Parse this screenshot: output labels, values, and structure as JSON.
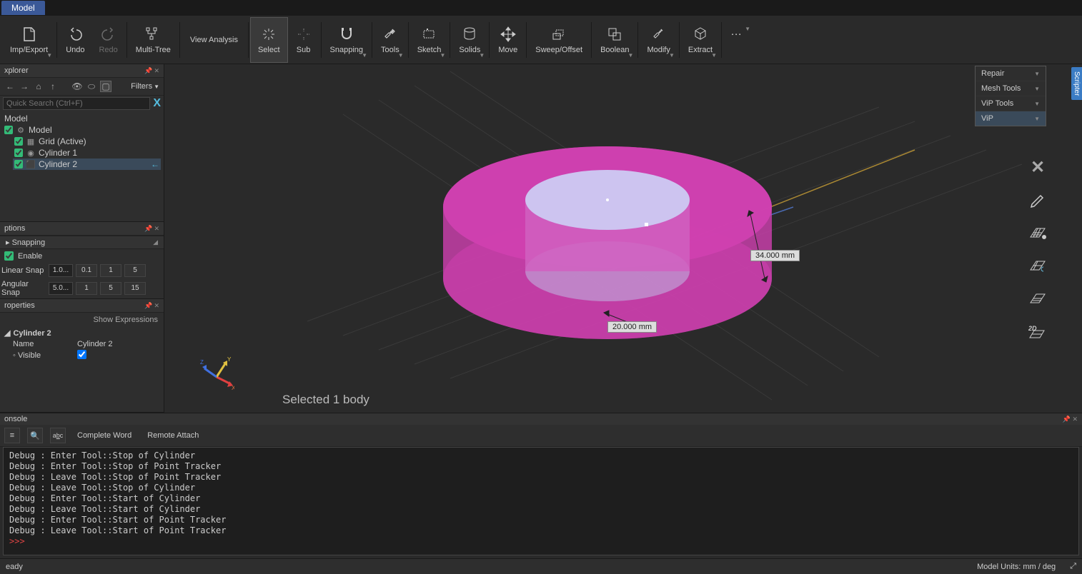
{
  "titlebar": {
    "tab": "Model"
  },
  "ribbon": {
    "import_export": "Imp/Export",
    "undo": "Undo",
    "redo": "Redo",
    "multitree": "Multi-Tree",
    "view_analysis": "View Analysis",
    "select": "Select",
    "sub": "Sub",
    "snapping": "Snapping",
    "tools": "Tools",
    "sketch": "Sketch",
    "solids": "Solids",
    "move": "Move",
    "sweep_offset": "Sweep/Offset",
    "boolean": "Boolean",
    "modify": "Modify",
    "extract": "Extract"
  },
  "repair_popup": {
    "repair": "Repair",
    "meshtools": "Mesh Tools",
    "viptools": "ViP Tools",
    "vip": "ViP"
  },
  "explorer": {
    "title": "xplorer",
    "filters_label": "Filters",
    "search_placeholder": "Quick Search (Ctrl+F)",
    "root": "Model",
    "model_label": "Model",
    "items": [
      {
        "label": "Grid (Active)",
        "checked": true
      },
      {
        "label": "Cylinder 1",
        "checked": true
      },
      {
        "label": "Cylinder 2",
        "checked": true,
        "selected": true
      }
    ]
  },
  "options": {
    "title": "ptions",
    "section": "Snapping",
    "enable_label": "Enable",
    "enable_checked": true,
    "linear_label": "Linear Snap",
    "linear_value": "1.0...",
    "linear_btns": [
      "0.1",
      "1",
      "5"
    ],
    "angular_label": "Angular Snap",
    "angular_value": "5.0...",
    "angular_btns": [
      "1",
      "5",
      "15"
    ]
  },
  "properties": {
    "title": "roperties",
    "show_expr": "Show Expressions",
    "group": "Cylinder 2",
    "rows": [
      {
        "name": "Name",
        "value": "Cylinder 2"
      },
      {
        "name": "Visible",
        "value": "",
        "checkbox": true
      }
    ]
  },
  "viewport": {
    "selected_text": "Selected 1 body",
    "dim_outer": "34.000 mm",
    "dim_inner": "20.000 mm",
    "axis_labels": {
      "x": "X",
      "y": "Y",
      "z": "Z"
    },
    "scripter": "Scripter"
  },
  "side_tools": [
    "close",
    "pencil",
    "grid1",
    "grid2",
    "grid3",
    "2d"
  ],
  "console": {
    "title": "onsole",
    "complete_word": "Complete Word",
    "remote_attach": "Remote Attach",
    "lines": [
      "Debug : Enter Tool::Stop of Cylinder",
      "Debug : Enter Tool::Stop of Point Tracker",
      "Debug : Leave Tool::Stop of Point Tracker",
      "Debug : Leave Tool::Stop of Cylinder",
      "Debug : Enter Tool::Start of Cylinder",
      "Debug : Leave Tool::Start of Cylinder",
      "Debug : Enter Tool::Start of Point Tracker",
      "Debug : Leave Tool::Start of Point Tracker"
    ],
    "prompt": ">>>"
  },
  "statusbar": {
    "ready": "eady",
    "units": "Model Units: mm / deg"
  }
}
